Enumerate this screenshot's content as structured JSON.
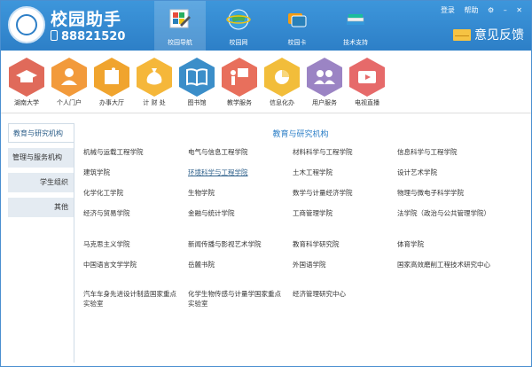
{
  "app": {
    "title": "校园助手",
    "phone": "88821520"
  },
  "nav_tabs": [
    {
      "label": "校园导航",
      "active": true
    },
    {
      "label": "校园网",
      "active": false
    },
    {
      "label": "校园卡",
      "active": false
    },
    {
      "label": "技术支持",
      "active": false
    }
  ],
  "top_links": {
    "login": "登录",
    "help": "帮助"
  },
  "feedback": "意见反馈",
  "icon_bar": [
    {
      "label": "湖南大学",
      "color": "#e06a5a"
    },
    {
      "label": "个人门户",
      "color": "#f29a3b"
    },
    {
      "label": "办事大厅",
      "color": "#f0a42e"
    },
    {
      "label": "计 财 处",
      "color": "#f5b73a"
    },
    {
      "label": "图书馆",
      "color": "#3b8ec9"
    },
    {
      "label": "教学服务",
      "color": "#e86f5c"
    },
    {
      "label": "信息化办",
      "color": "#f2bd3a"
    },
    {
      "label": "用户服务",
      "color": "#9b84c4"
    },
    {
      "label": "电视直播",
      "color": "#e66a6a"
    }
  ],
  "sidebar": [
    {
      "label": "教育与研究机构",
      "active": true
    },
    {
      "label": "管理与服务机构",
      "active": false
    },
    {
      "label": "学生组织",
      "active": false
    },
    {
      "label": "其他",
      "active": false
    }
  ],
  "content": {
    "title": "教育与研究机构",
    "rows": [
      [
        "机械与运载工程学院",
        "电气与信息工程学院",
        "材料科学与工程学院",
        "信息科学与工程学院"
      ],
      [
        "建筑学院",
        "环境科学与工程学院",
        "土木工程学院",
        "设计艺术学院"
      ],
      [
        "化学化工学院",
        "生物学院",
        "数学与计量经济学院",
        "物理与微电子科学学院"
      ],
      [
        "经济与贸易学院",
        "金融与统计学院",
        "工商管理学院",
        "法学院（政治与公共管理学院）"
      ],
      [
        "马克思主义学院",
        "新闻传播与影视艺术学院",
        "教育科学研究院",
        "体育学院"
      ],
      [
        "中国语言文学学院",
        "岳麓书院",
        "外国语学院",
        "国家高效磨削工程技术研究中心"
      ],
      [
        "汽车车身先进设计制造国家重点实验室",
        "化学生物传感与计量学国家重点实验室",
        "经济管理研究中心",
        ""
      ]
    ],
    "highlighted": "环境科学与工程学院"
  }
}
